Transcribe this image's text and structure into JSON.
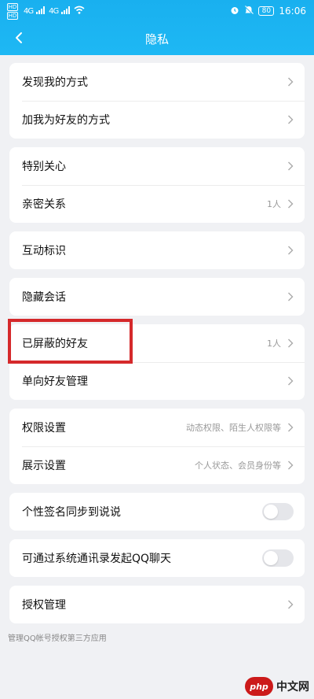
{
  "status_bar": {
    "sim_labels": [
      "HD",
      "HD"
    ],
    "network_1": "4G",
    "network_2": "4G",
    "battery": "80",
    "time": "16:06"
  },
  "nav": {
    "title": "隐私"
  },
  "groups": [
    {
      "rows": [
        {
          "label": "发现我的方式",
          "value": ""
        },
        {
          "label": "加我为好友的方式",
          "value": ""
        }
      ]
    },
    {
      "rows": [
        {
          "label": "特别关心",
          "value": ""
        },
        {
          "label": "亲密关系",
          "value": "1人"
        }
      ]
    },
    {
      "rows": [
        {
          "label": "互动标识",
          "value": ""
        }
      ]
    },
    {
      "rows": [
        {
          "label": "隐藏会话",
          "value": ""
        }
      ]
    },
    {
      "rows": [
        {
          "label": "已屏蔽的好友",
          "value": "1人"
        },
        {
          "label": "单向好友管理",
          "value": ""
        }
      ]
    },
    {
      "rows": [
        {
          "label": "权限设置",
          "value": "动态权限、陌生人权限等"
        },
        {
          "label": "展示设置",
          "value": "个人状态、会员身份等"
        }
      ]
    },
    {
      "rows": [
        {
          "label": "个性签名同步到说说",
          "toggle": false
        }
      ]
    },
    {
      "rows": [
        {
          "label": "可通过系统通讯录发起QQ聊天",
          "toggle": false
        }
      ]
    },
    {
      "rows": [
        {
          "label": "授权管理",
          "value": ""
        }
      ]
    }
  ],
  "footer_note": "管理QQ帐号授权第三方应用",
  "watermark": {
    "logo_text": "php",
    "site_text": "中文网"
  },
  "colors": {
    "header": "#1eb8f4",
    "highlight_box": "#d5292b",
    "background": "#f0f1f4"
  }
}
